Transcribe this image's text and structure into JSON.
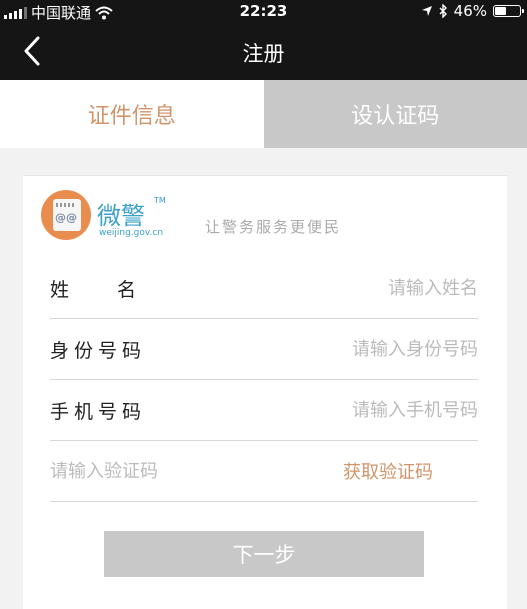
{
  "statusbar": {
    "carrier": "中国联通",
    "time": "22:23",
    "battery": "46%",
    "battery_level": 0.46
  },
  "navbar": {
    "title": "注册"
  },
  "tabs": [
    {
      "label": "证件信息",
      "active": true
    },
    {
      "label": "设认证码",
      "active": false
    }
  ],
  "brand": {
    "name": "微警",
    "tm": "TM",
    "url": "weijing.gov.cn",
    "slogan": "让警务服务更便民"
  },
  "form": {
    "name": {
      "label": "姓名",
      "placeholder": "请输入姓名"
    },
    "id_number": {
      "label": "身份号码",
      "placeholder": "请输入身份号码"
    },
    "phone": {
      "label": "手机号码",
      "placeholder": "请输入手机号码"
    },
    "code": {
      "placeholder": "请输入验证码",
      "get_code_label": "获取验证码"
    }
  },
  "next_button": "下一步",
  "colors": {
    "accent": "#d0956a",
    "bar": "#151515",
    "disabled": "#c8c8c8",
    "brand": "#3aa0c9"
  },
  "icons": {
    "back": "chevron-left-icon",
    "signal": "signal-icon",
    "wifi": "wifi-icon",
    "location": "location-arrow-icon",
    "bluetooth": "bluetooth-icon",
    "battery": "battery-icon"
  }
}
